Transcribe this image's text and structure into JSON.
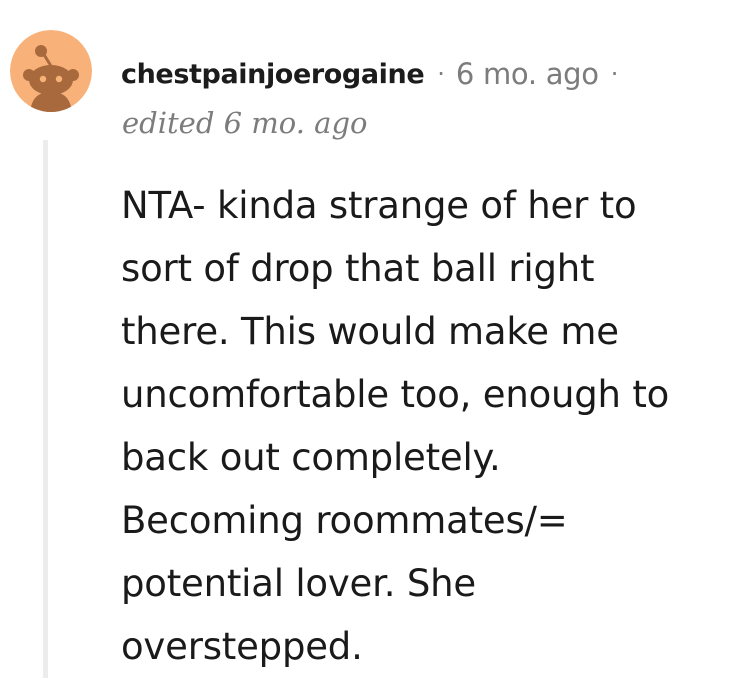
{
  "comment": {
    "author": "chestpainjoerogaine",
    "separator": "·",
    "timestamp": "6 mo. ago",
    "edited": "edited 6 mo. ago",
    "body_lines": [
      "NTA- kinda strange of her to",
      "sort of drop that ball right",
      "there. This would make me",
      "uncomfortable too, enough to",
      "back out completely.",
      "Becoming roommates/=",
      "potential lover. She",
      "overstepped."
    ],
    "avatar_icon": "snoo-avatar-icon"
  },
  "colors": {
    "avatar_background": "#f8b179",
    "avatar_figure": "#a86a3d",
    "meta_text": "#7c7c7c",
    "thread_line": "#ececec",
    "body_text": "#1a1a1b"
  }
}
